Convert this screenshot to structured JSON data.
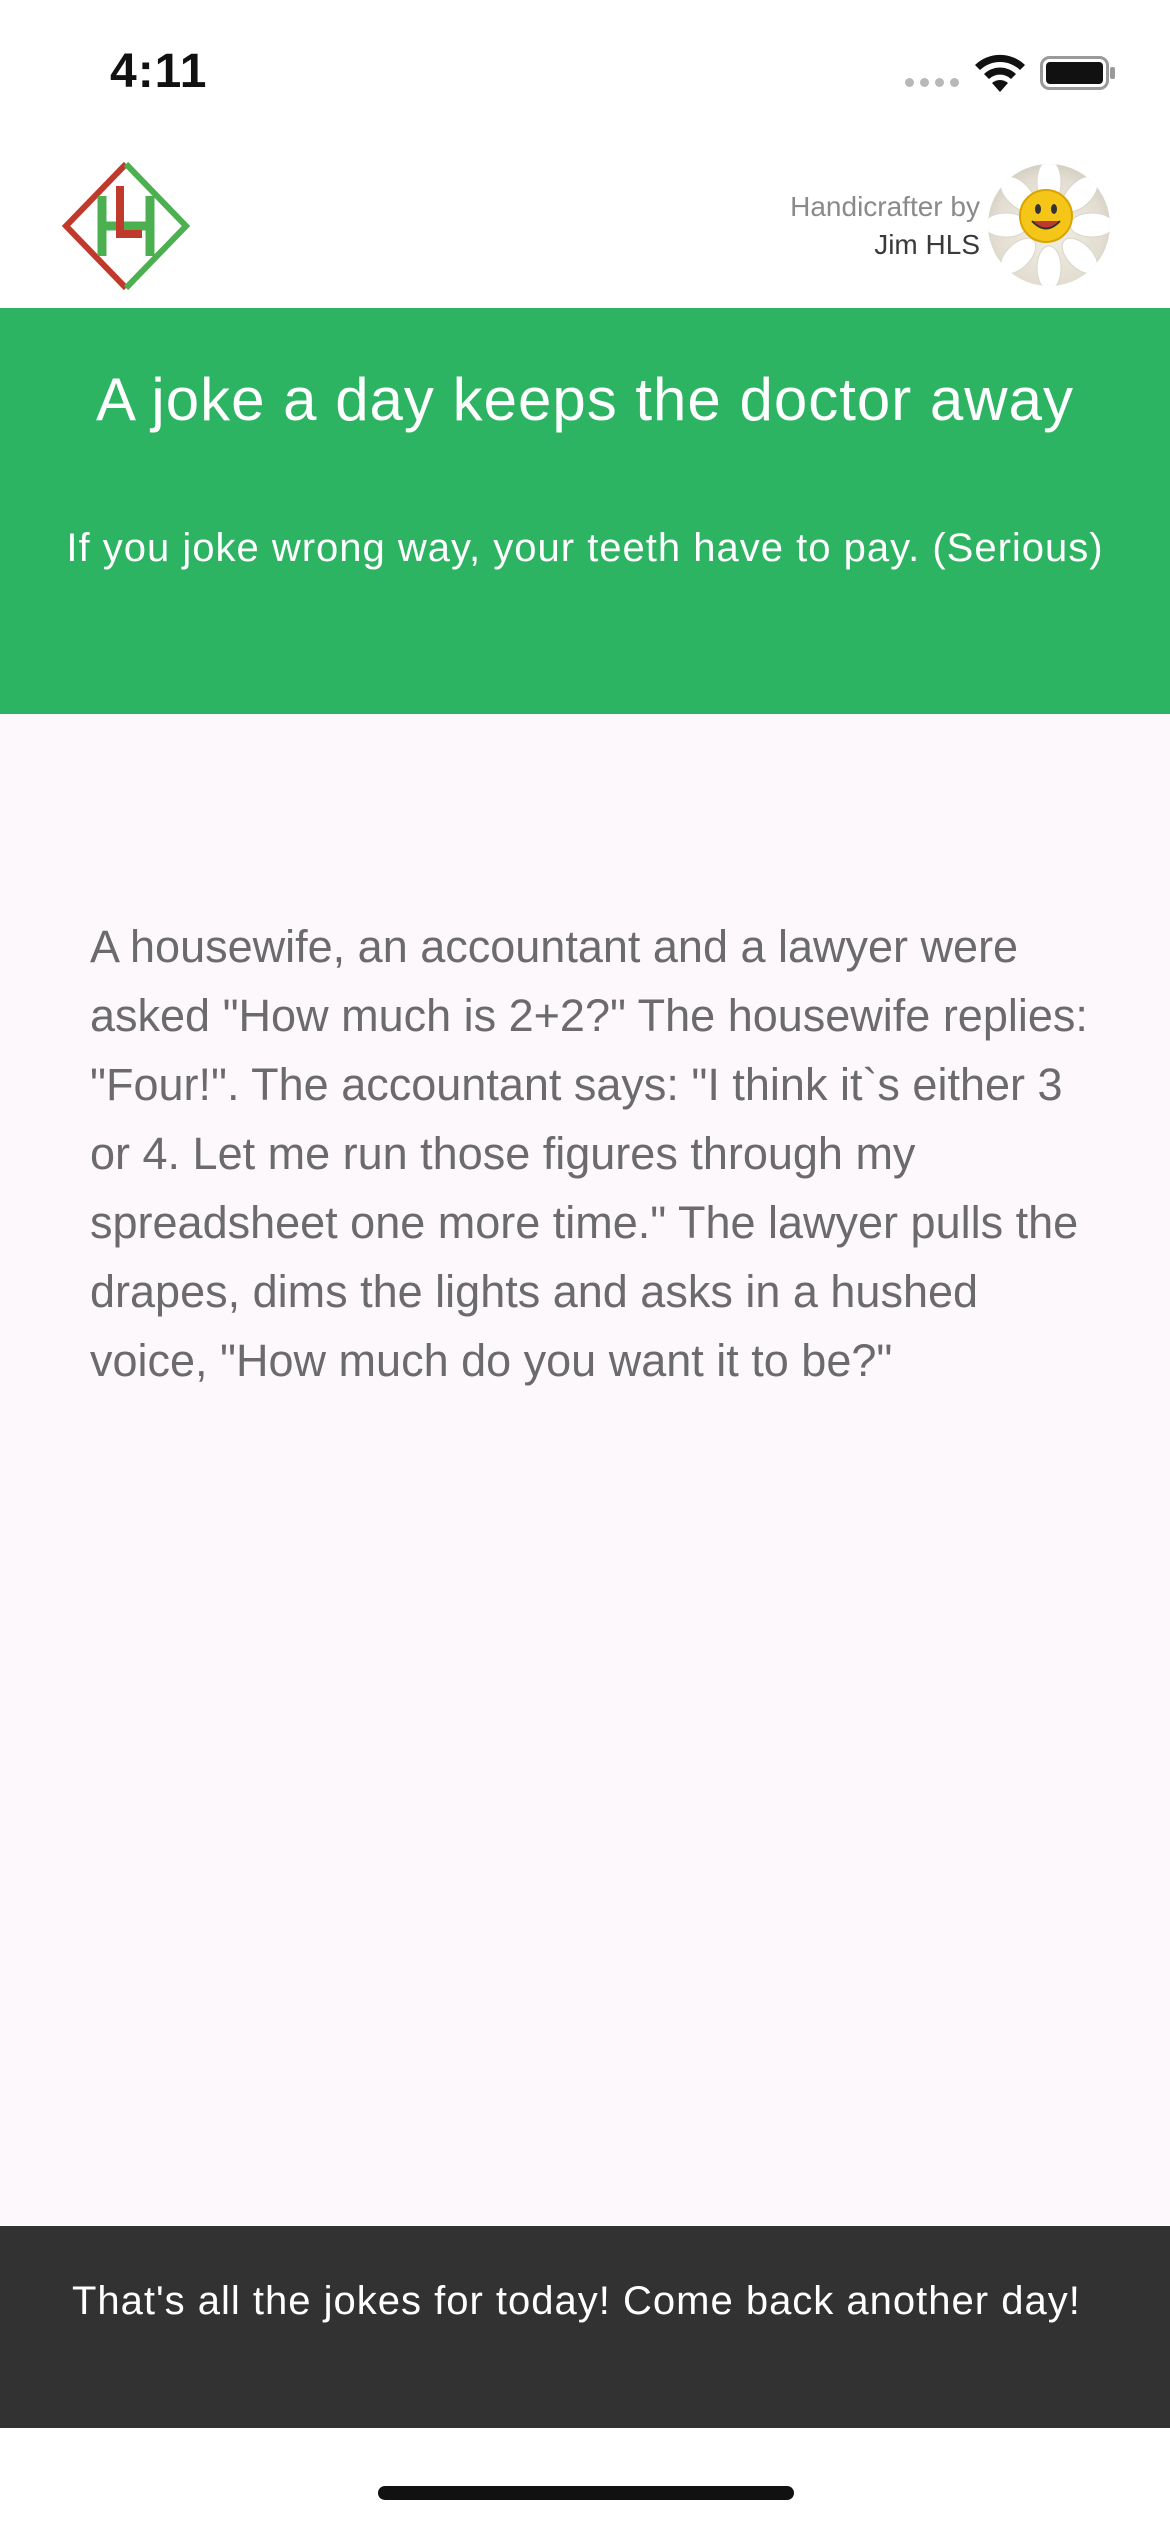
{
  "status_bar": {
    "time": "4:11",
    "icons": [
      "signal-dots-icon",
      "wifi-icon",
      "battery-icon"
    ]
  },
  "header": {
    "logo_icon": "hls-logo-icon",
    "credit_label": "Handicrafter by",
    "credit_name": "Jim HLS",
    "avatar_icon": "smiley-flower-avatar"
  },
  "banner": {
    "title": "A joke a day keeps the doctor away",
    "subtitle": "If you joke wrong way, your teeth have to pay. (Serious)"
  },
  "joke": {
    "text": "A housewife, an accountant and a lawyer were asked \"How much is 2+2?\" The housewife replies: \"Four!\". The accountant says: \"I think it`s either 3 or 4. Let me run those figures through my spreadsheet one more time.\" The lawyer pulls the drapes, dims the lights and asks in a hushed voice, \"How much do you want it to be?\""
  },
  "snackbar": {
    "message": "That's all the jokes for today! Come back another day!"
  },
  "colors": {
    "banner": "#2db462",
    "content_bg": "#fdf8fc",
    "snackbar_bg": "#323232",
    "logo_red": "#c0392b",
    "logo_green": "#4caf50"
  }
}
